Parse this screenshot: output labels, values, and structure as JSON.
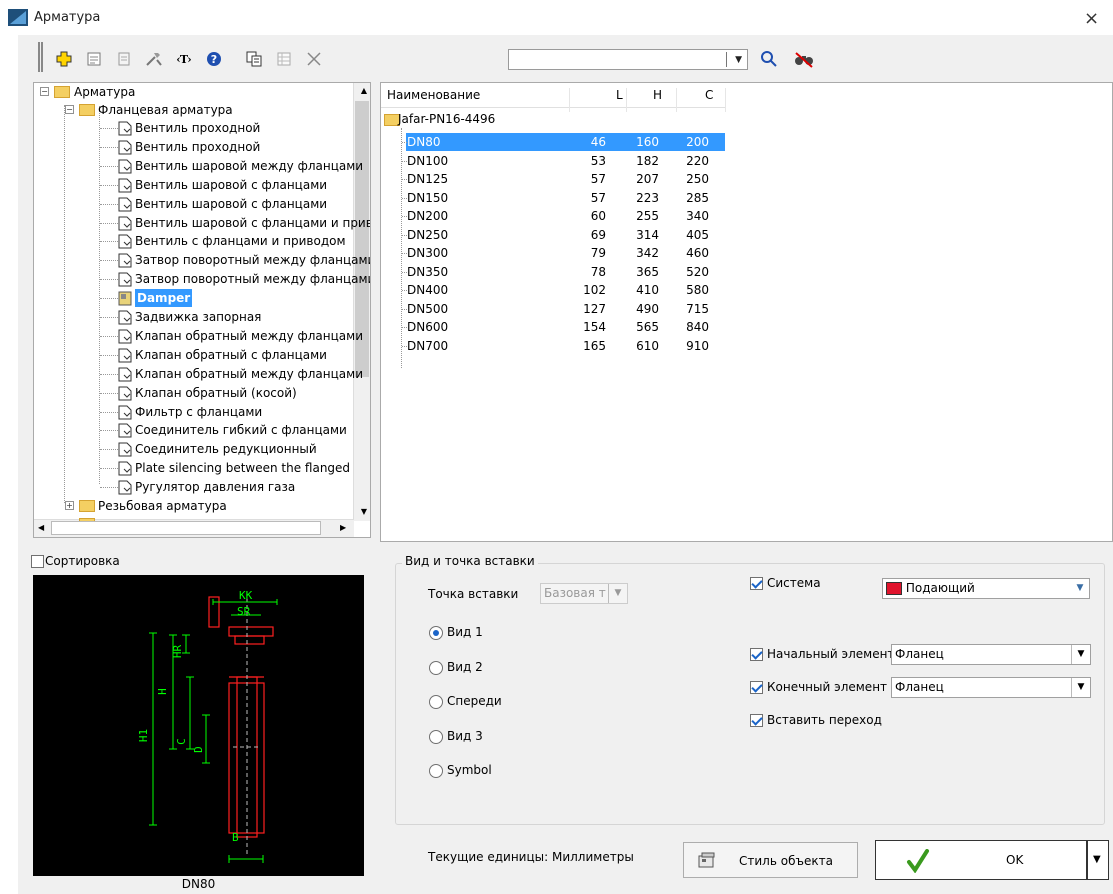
{
  "window": {
    "title": "Арматура",
    "close": "×"
  },
  "toolbar": {
    "search_value": "",
    "icons": [
      "add-icon",
      "properties-icon",
      "document-icon",
      "tools-icon",
      "text-tag-icon",
      "help-icon",
      "copy-icon",
      "table-icon",
      "delete-icon",
      "search-icon",
      "binoculars-icon"
    ]
  },
  "tree": {
    "root": "Арматура",
    "group": "Фланцевая арматура",
    "items": [
      "Вентиль проходной",
      "Вентиль проходной",
      "Вентиль шаровой между фланцами",
      "Вентиль шаровой с фланцами",
      "Вентиль шаровой с фланцами",
      "Вентиль шаровой с фланцами и приво",
      "Вентиль с фланцами и приводом",
      "Затвор поворотный между фланцами",
      "Затвор поворотный между фланцами",
      "Damper",
      "Задвижка запорная",
      "Клапан обратный между фланцами",
      "Клапан обратный с фланцами",
      "Клапан обратный между фланцами",
      "Клапан обратный (косой)",
      "Фильтр с фланцами",
      "Соединитель гибкий с фланцами",
      "Соединитель редукционный",
      "Plate silencing between the flanged",
      "Ругулятор давления газа"
    ],
    "selected": "Damper",
    "group2": "Резьбовая арматура"
  },
  "grid": {
    "columns": [
      "Наименование",
      "L",
      "H",
      "C"
    ],
    "folder": "Jafar-PN16-4496",
    "rows": [
      [
        "DN80",
        "46",
        "160",
        "200"
      ],
      [
        "DN100",
        "53",
        "182",
        "220"
      ],
      [
        "DN125",
        "57",
        "207",
        "250"
      ],
      [
        "DN150",
        "57",
        "223",
        "285"
      ],
      [
        "DN200",
        "60",
        "255",
        "340"
      ],
      [
        "DN250",
        "69",
        "314",
        "405"
      ],
      [
        "DN300",
        "79",
        "342",
        "460"
      ],
      [
        "DN350",
        "78",
        "365",
        "520"
      ],
      [
        "DN400",
        "102",
        "410",
        "580"
      ],
      [
        "DN500",
        "127",
        "490",
        "715"
      ],
      [
        "DN600",
        "154",
        "565",
        "840"
      ],
      [
        "DN700",
        "165",
        "610",
        "910"
      ]
    ],
    "selected_row": "DN80"
  },
  "sorting_label": "Сортировка",
  "preview": {
    "caption": "DN80",
    "labels": [
      "KK",
      "SR",
      "HR",
      "H",
      "H1",
      "C",
      "D",
      "B"
    ]
  },
  "insert": {
    "group_title": "Вид и точка вставки",
    "point_label": "Точка вставки",
    "point_value": "Базовая т",
    "views": [
      "Вид 1",
      "Вид 2",
      "Спереди",
      "Вид 3",
      "Symbol"
    ],
    "selected_view": "Вид 1",
    "system_label": "Система",
    "system_value": "Подающий",
    "system_color": "#e0142d",
    "start_label": "Начальный элемент",
    "start_value": "Фланец",
    "end_label": "Конечный элемент",
    "end_value": "Фланец",
    "transition_label": "Вставить переход"
  },
  "footer": {
    "units": "Текущие единицы: Миллиметры",
    "style_button": "Стиль объекта",
    "ok": "OK"
  }
}
